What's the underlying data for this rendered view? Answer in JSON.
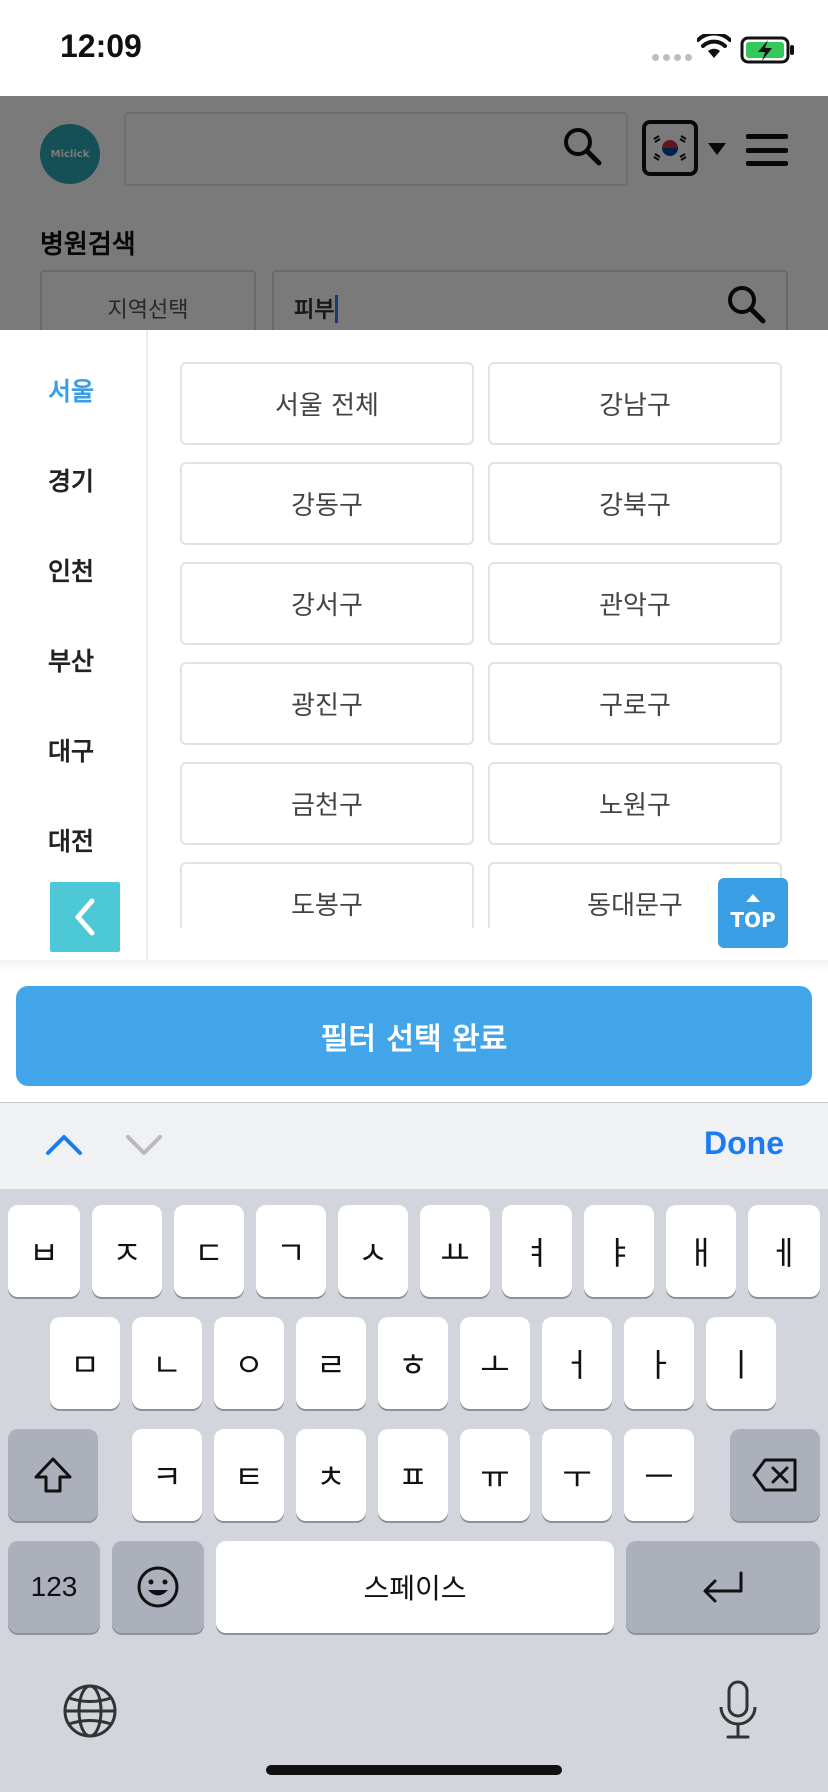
{
  "status_bar": {
    "time": "12:09"
  },
  "header": {
    "logo_text": "Miclick",
    "section_title": "병원검색",
    "region_button": "지역선택",
    "keyword_value": "피부"
  },
  "filter": {
    "cities": [
      {
        "label": "서울",
        "active": true
      },
      {
        "label": "경기",
        "active": false
      },
      {
        "label": "인천",
        "active": false
      },
      {
        "label": "부산",
        "active": false
      },
      {
        "label": "대구",
        "active": false
      },
      {
        "label": "대전",
        "active": false
      }
    ],
    "districts": [
      "서울 전체",
      "강남구",
      "강동구",
      "강북구",
      "강서구",
      "관악구",
      "광진구",
      "구로구",
      "금천구",
      "노원구",
      "도봉구",
      "동대문구"
    ],
    "top_button": "TOP",
    "confirm_button": "필터 선택 완료"
  },
  "keyboard": {
    "done_label": "Done",
    "row1": [
      "ㅂ",
      "ㅈ",
      "ㄷ",
      "ㄱ",
      "ㅅ",
      "ㅛ",
      "ㅕ",
      "ㅑ",
      "ㅐ",
      "ㅔ"
    ],
    "row2": [
      "ㅁ",
      "ㄴ",
      "ㅇ",
      "ㄹ",
      "ㅎ",
      "ㅗ",
      "ㅓ",
      "ㅏ",
      "ㅣ"
    ],
    "row3": [
      "ㅋ",
      "ㅌ",
      "ㅊ",
      "ㅍ",
      "ㅠ",
      "ㅜ",
      "ㅡ"
    ],
    "numbers_label": "123",
    "space_label": "스페이스"
  },
  "colors": {
    "accent": "#3a9ee4",
    "confirm": "#42a5ea",
    "back_button": "#4cc8d6",
    "done": "#1a7cf0"
  }
}
